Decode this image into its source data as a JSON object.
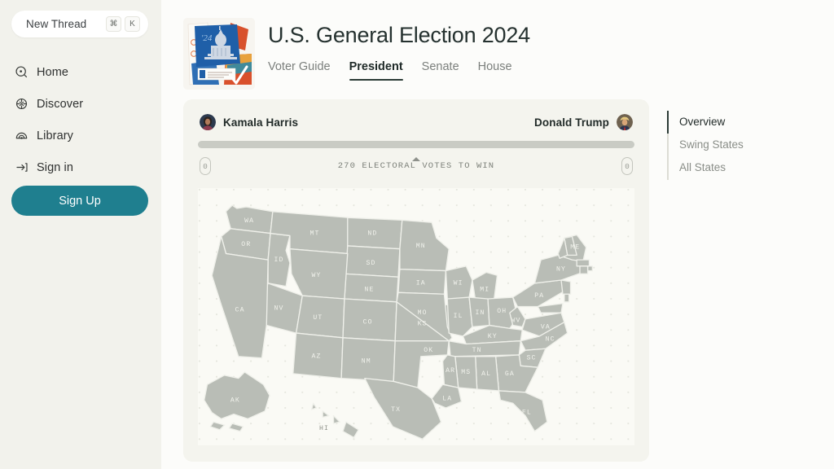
{
  "sidebar": {
    "new_thread": {
      "label": "New Thread",
      "keys": [
        "⌘",
        "K"
      ]
    },
    "items": [
      {
        "label": "Home",
        "icon": "home-search-icon"
      },
      {
        "label": "Discover",
        "icon": "discover-globe-icon"
      },
      {
        "label": "Library",
        "icon": "library-arc-icon"
      },
      {
        "label": "Sign in",
        "icon": "sign-in-arrow-icon"
      }
    ],
    "signup_label": "Sign Up",
    "accent_color": "#1f7f8f",
    "background_color": "#f2f2ec"
  },
  "header": {
    "title": "U.S. General Election 2024",
    "thumbnail_alt": "election-collage-thumbnail",
    "tabs": [
      {
        "label": "Voter Guide",
        "active": false
      },
      {
        "label": "President",
        "active": true
      },
      {
        "label": "Senate",
        "active": false
      },
      {
        "label": "House",
        "active": false
      }
    ]
  },
  "result_card": {
    "candidates": [
      {
        "name": "Kamala Harris",
        "side": "left",
        "electoral_votes": "0",
        "avatar": "kamala-harris-avatar"
      },
      {
        "name": "Donald Trump",
        "side": "right",
        "electoral_votes": "0",
        "avatar": "donald-trump-avatar"
      }
    ],
    "votes_to_win_label": "270 ELECTORAL VOTES TO WIN",
    "bar_fill_color": "#c9cbc4",
    "card_background": "#f4f4ee"
  },
  "side_nav": {
    "items": [
      {
        "label": "Overview",
        "active": true
      },
      {
        "label": "Swing States",
        "active": false
      },
      {
        "label": "All States",
        "active": false
      }
    ]
  },
  "map": {
    "state_fill": "#b9bdb6",
    "state_stroke": "#eff0ea",
    "label_color": "#f1f2ec",
    "ocean_color": "#fafaf5",
    "states": [
      "WA",
      "OR",
      "ID",
      "MT",
      "ND",
      "MN",
      "WI",
      "MI",
      "NY",
      "ME",
      "NH",
      "VT",
      "MA",
      "RI",
      "CT",
      "PA",
      "NJ",
      "OH",
      "IN",
      "IL",
      "IA",
      "SD",
      "NE",
      "WY",
      "NV",
      "CA",
      "UT",
      "CO",
      "KS",
      "MO",
      "KY",
      "WV",
      "VA",
      "MD",
      "DE",
      "NC",
      "TN",
      "SC",
      "GA",
      "AL",
      "MS",
      "AR",
      "LA",
      "OK",
      "TX",
      "NM",
      "AZ",
      "FL",
      "AK",
      "HI"
    ]
  }
}
